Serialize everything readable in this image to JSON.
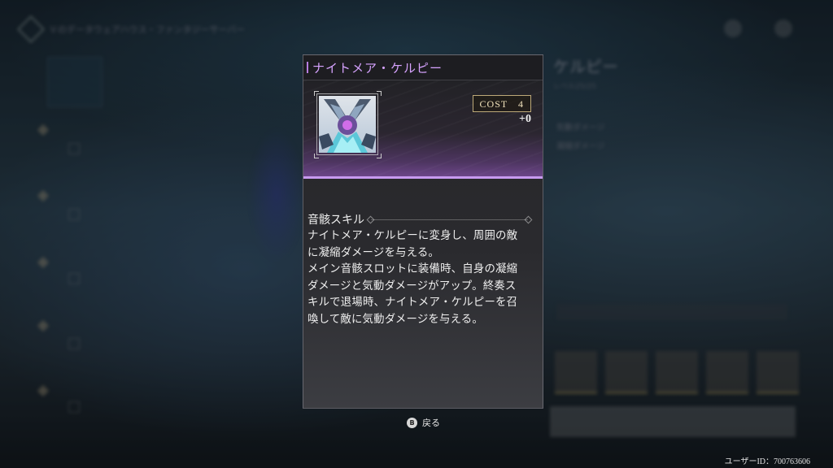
{
  "background": {
    "breadcrumb": "Ｖのデータウェアハウス・ファンタジーサーバー",
    "right_panel": {
      "title": "ケルピー",
      "subtitle": "レベル25/25",
      "lines": [
        "気動ダメージ",
        "凝縮ダメージ"
      ],
      "button_label": "装備固定"
    }
  },
  "card": {
    "title": "ナイトメア・ケルピー",
    "cost": "COST　4",
    "bonus": "+0",
    "section_title": "音骸スキル",
    "description": "ナイトメア・ケルピーに変身し、周囲の敵\nに凝縮ダメージを与える。\nメイン音骸スロットに装備時、自身の凝縮\nダメージと気動ダメージがアップ。終奏ス\nキルで退場時、ナイトメア・ケルピーを召\n喚して敵に気動ダメージを与える。"
  },
  "footer": {
    "back_key": "B",
    "back_label": "戻る",
    "user_id": "ユーザーID：700763606"
  },
  "icons": {
    "card_icon": "nightmare-kelpie-portrait",
    "back_key_icon": "b-button-icon"
  },
  "colors": {
    "accent": "#c79af0",
    "title": "#d7a3ff",
    "cost_border": "#bda978"
  }
}
